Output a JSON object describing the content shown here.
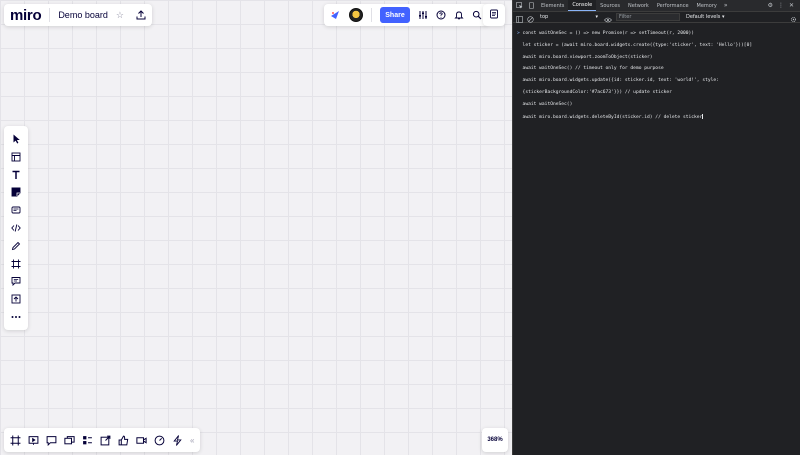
{
  "board": {
    "logo": "miro",
    "title": "Demo board",
    "share_label": "Share",
    "zoom_level": "368%",
    "toolbar_tools": [
      "select",
      "templates",
      "text",
      "sticky-note",
      "card",
      "embed",
      "pen",
      "frame",
      "comment",
      "upload",
      "more"
    ],
    "bottom_tools": [
      "frames",
      "present",
      "comments",
      "cards",
      "kanban",
      "integrations",
      "reactions",
      "video",
      "timer",
      "apps"
    ]
  },
  "devtools": {
    "tabs": [
      "Elements",
      "Console",
      "Sources",
      "Network",
      "Performance",
      "Memory"
    ],
    "active_tab": "Console",
    "more_tabs": "»",
    "context": "top",
    "filter_placeholder": "Filter",
    "levels_label": "Default levels ▾",
    "console_lines": [
      "const waitOneSec = () => new Promise(r => setTimeout(r, 2000))",
      "let sticker = (await miro.board.widgets.create({type:'sticker', text: 'Hello'}))[0]",
      "await miro.board.viewport.zoomToObject(sticker)",
      "await waitOneSec() // timeout only for demo purpose",
      "await miro.board.widgets.update({id: sticker.id, text: 'world!', style:",
      "{stickerBackgroundColor:'#7ac673'}}) // update sticker",
      "await waitOneSec()",
      "await miro.board.widgets.deleteById(sticker.id) // delete sticker"
    ]
  },
  "colors": {
    "board_bg": "#f2f1f4",
    "share_blue": "#4262ff",
    "devtools_bg": "#202124"
  }
}
